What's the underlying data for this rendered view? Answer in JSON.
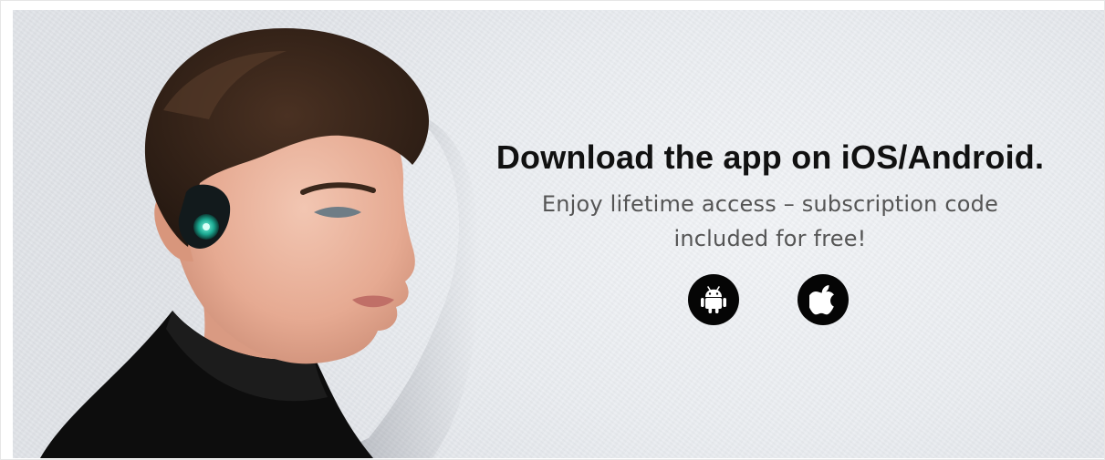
{
  "banner": {
    "headline": "Download the app on iOS/Android.",
    "subline": "Enjoy lifetime access – subscription code included for free!"
  },
  "stores": [
    {
      "name": "android",
      "icon": "android-icon"
    },
    {
      "name": "ios",
      "icon": "apple-icon"
    }
  ],
  "colors": {
    "background": "#e9ecf0",
    "headline": "#111111",
    "subline": "#555555",
    "button": "#050505"
  }
}
